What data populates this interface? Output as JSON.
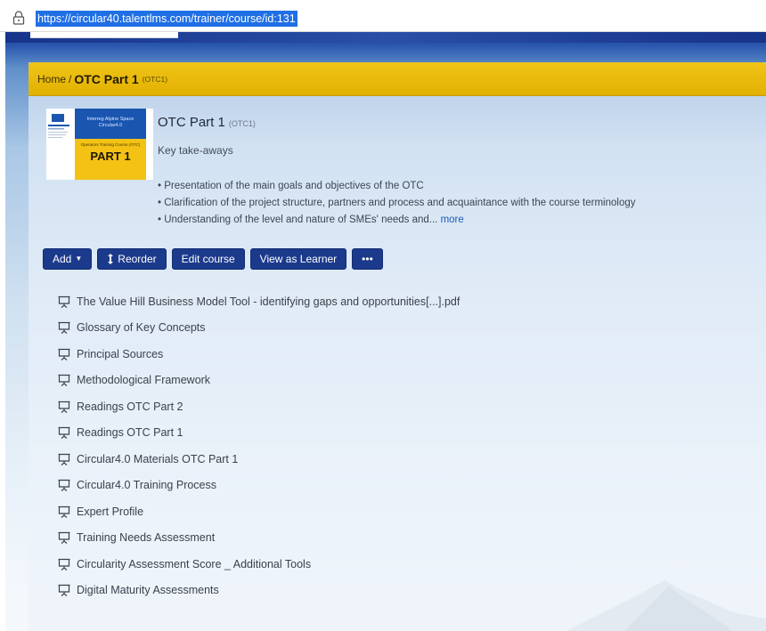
{
  "browser": {
    "url": "https://circular40.talentlms.com/trainer/course/id:131",
    "lock_icon": "lock-icon"
  },
  "breadcrumb": {
    "home": "Home",
    "separator": "/",
    "current": "OTC Part 1",
    "code": "(OTC1)"
  },
  "course": {
    "title": "OTC Part 1",
    "code": "(OTC1)",
    "subtitle": "Key take-aways",
    "bullets": [
      "• Presentation of the main goals and objectives of the OTC",
      "• Clarification of the project structure, partners and process and acquaintance with the course terminology",
      "• Understanding of the level and nature of SMEs' needs and..."
    ],
    "more": "more",
    "thumbnail": {
      "top_text": "Interreg Alpine Space Circular4.0",
      "sub_text": "Operators Training Course (OTC)",
      "part": "PART 1"
    }
  },
  "toolbar": {
    "add": "Add",
    "reorder": "Reorder",
    "edit": "Edit course",
    "view": "View as Learner",
    "more": "•••"
  },
  "units": [
    "The Value Hill Business Model Tool - identifying gaps and opportunities[...].pdf",
    "Glossary of Key Concepts",
    "Principal Sources",
    "Methodological Framework",
    "Readings OTC Part 2",
    "Readings OTC Part 1",
    "Circular4.0 Materials OTC Part 1",
    "Circular4.0 Training Process",
    "Expert Profile",
    "Training Needs Assessment",
    "Circularity Assessment Score _ Additional Tools",
    "Digital Maturity Assessments"
  ],
  "colors": {
    "breadcrumb_bar": "#e9b80c",
    "button": "#1b3a8c",
    "link": "#1d5fb8",
    "url_highlight": "#1f6fe5"
  }
}
